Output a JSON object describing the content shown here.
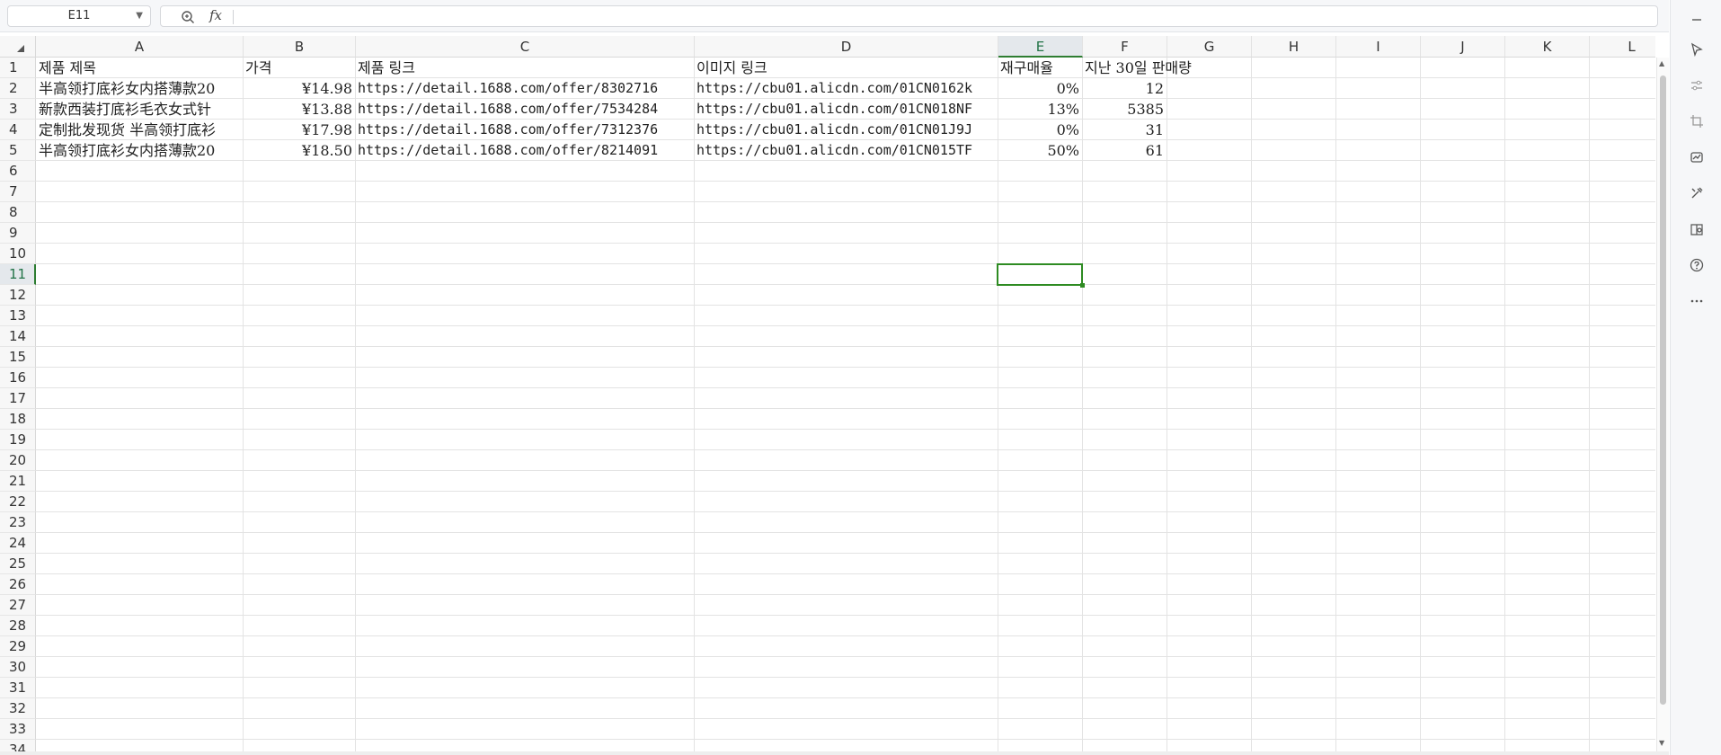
{
  "name_box": {
    "value": "E11"
  },
  "formula_bar": {
    "fx_label": "fx",
    "value": ""
  },
  "columns": [
    "A",
    "B",
    "C",
    "D",
    "E",
    "F",
    "G",
    "H",
    "I",
    "J",
    "K",
    "L"
  ],
  "selected_column": "E",
  "row_numbers": [
    "1",
    "2",
    "3",
    "4",
    "5",
    "6",
    "7",
    "8",
    "9",
    "10",
    "11",
    "12",
    "13",
    "14",
    "15",
    "16",
    "17",
    "18",
    "19",
    "20",
    "21",
    "22",
    "23",
    "24",
    "25",
    "26",
    "27",
    "28",
    "29",
    "30",
    "31",
    "32",
    "33",
    "34"
  ],
  "selected_row": "11",
  "sheet": {
    "headers": {
      "a": "제품 제목",
      "b": "가격",
      "c": "제품 링크",
      "d": "이미지 링크",
      "e": "재구매율",
      "f": "지난 30일 판매량"
    },
    "rows": [
      {
        "title": "半高领打底衫女内搭薄款20",
        "price": "¥14.98",
        "link": "https://detail.1688.com/offer/8302716",
        "image": "https://cbu01.alicdn.com/01CN0162k",
        "repurchase": "0%",
        "sales": "12"
      },
      {
        "title": "新款西装打底衫毛衣女式针",
        "price": "¥13.88",
        "link": "https://detail.1688.com/offer/7534284",
        "image": "https://cbu01.alicdn.com/01CN018NF",
        "repurchase": "13%",
        "sales": "5385"
      },
      {
        "title": "定制批发现货 半高领打底衫",
        "price": "¥17.98",
        "link": "https://detail.1688.com/offer/7312376",
        "image": "https://cbu01.alicdn.com/01CN01J9J",
        "repurchase": "0%",
        "sales": "31"
      },
      {
        "title": "半高领打底衫女内搭薄款20",
        "price": "¥18.50",
        "link": "https://detail.1688.com/offer/8214091",
        "image": "https://cbu01.alicdn.com/01CN015TF",
        "repurchase": "50%",
        "sales": "61"
      }
    ]
  },
  "tools": [
    "minimize-icon",
    "select-cursor-icon",
    "adjust-sliders-icon",
    "crop-icon",
    "chart-icon",
    "tools-icon",
    "book-search-icon",
    "help-icon",
    "more-icon"
  ],
  "colors": {
    "selection": "#2e8b22",
    "header_bg": "#f7f7f7",
    "gridline": "#e3e3e3"
  }
}
